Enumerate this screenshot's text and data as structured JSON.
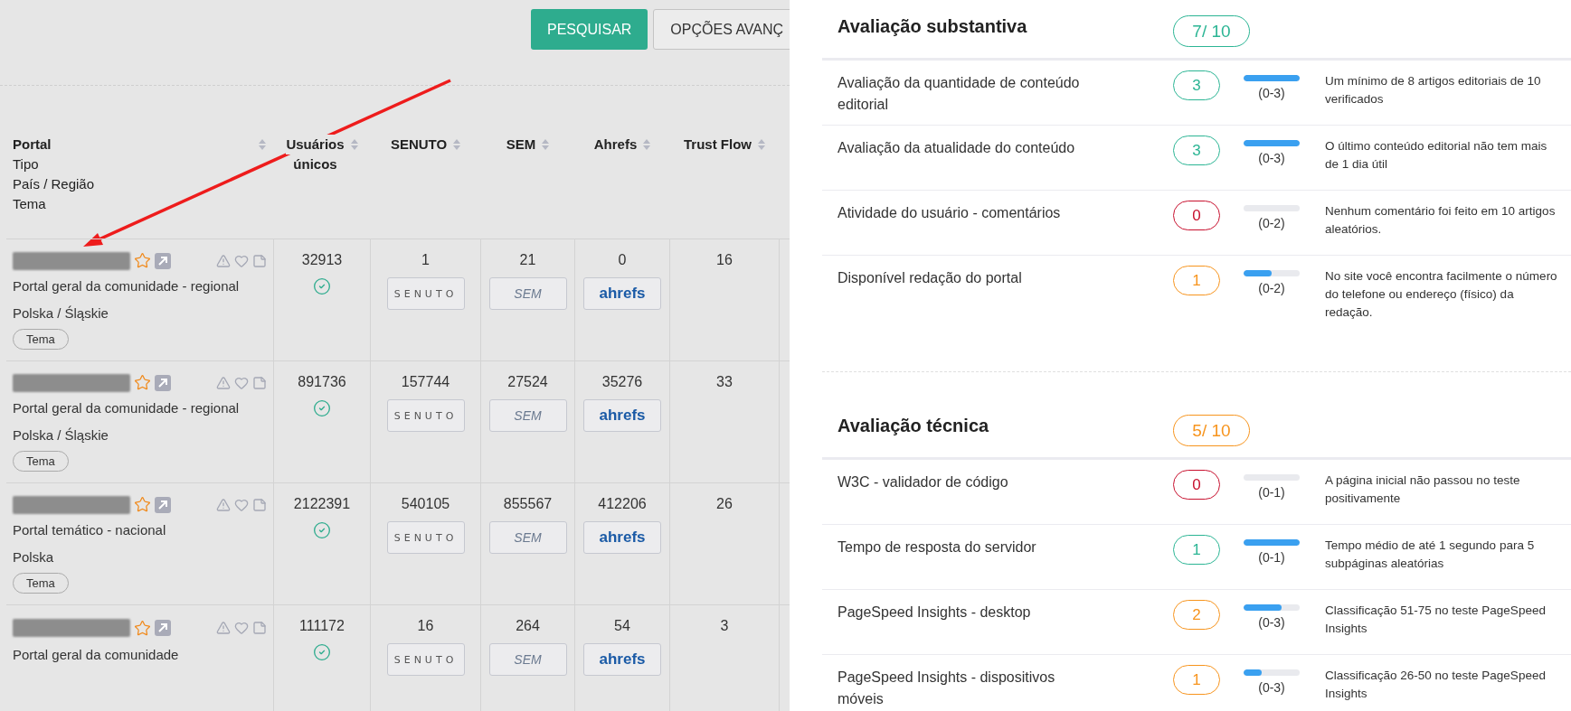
{
  "toolbar": {
    "buttons": [
      {
        "label": "PESQUISAR",
        "kind": "primary"
      },
      {
        "label": "OPÇÕES AVANÇ",
        "kind": "outline"
      }
    ]
  },
  "table": {
    "columns": [
      {
        "lines": [
          "Portal",
          "Tipo",
          "País / Região",
          "Tema"
        ]
      },
      {
        "lines": [
          "Usuários",
          "únicos"
        ]
      },
      {
        "lines": [
          "SENUTO"
        ]
      },
      {
        "lines": [
          "SEM"
        ]
      },
      {
        "lines": [
          "Ahrefs"
        ]
      },
      {
        "lines": [
          "Trust Flow"
        ]
      }
    ],
    "rows": [
      {
        "type": "Portal geral da comunidade - regional",
        "region": "Polska / Śląskie",
        "tag": "Tema",
        "users": "32913",
        "verified": true,
        "senuto": "1",
        "senuto_logo": "SENUTO",
        "sem": "21",
        "sem_logo": "SEM",
        "ahrefs": "0",
        "ahrefs_logo": "ahrefs",
        "trust": "16"
      },
      {
        "type": "Portal geral da comunidade - regional",
        "region": "Polska / Śląskie",
        "tag": "Tema",
        "users": "891736",
        "verified": true,
        "senuto": "157744",
        "senuto_logo": "SENUTO",
        "sem": "27524",
        "sem_logo": "SEM",
        "ahrefs": "35276",
        "ahrefs_logo": "ahrefs",
        "trust": "33"
      },
      {
        "type": "Portal temático - nacional",
        "region": "Polska",
        "tag": "Tema",
        "users": "2122391",
        "verified": true,
        "senuto": "540105",
        "senuto_logo": "SENUTO",
        "sem": "855567",
        "sem_logo": "SEM",
        "ahrefs": "412206",
        "ahrefs_logo": "ahrefs",
        "trust": "26"
      },
      {
        "type": "Portal geral da comunidade",
        "users": "111172",
        "verified": true,
        "senuto": "16",
        "senuto_logo": "SENUTO",
        "sem": "264",
        "sem_logo": "SEM",
        "ahrefs": "54",
        "ahrefs_logo": "ahrefs",
        "trust": "3"
      }
    ]
  },
  "sections": [
    {
      "title": "Avaliação substantiva",
      "score": "7/ 10",
      "color": "#2bb594",
      "items": [
        {
          "name": "Avaliação da quantidade de conteúdo editorial",
          "score": "3",
          "color": "#2bb594",
          "level": 1,
          "range": "(0-3)",
          "description": "Um mínimo de 8 artigos editoriais de 10 verificados"
        },
        {
          "name": "Avaliação da atualidade do conteúdo",
          "score": "3",
          "color": "#2bb594",
          "level": 1,
          "range": "(0-3)",
          "description": "O último conteúdo editorial não tem mais de 1 dia útil"
        },
        {
          "name": "Atividade do usuário - comentários",
          "score": "0",
          "color": "#c8102e",
          "level": 0,
          "range": "(0-2)",
          "description": "Nenhum comentário foi feito em 10 artigos aleatórios."
        },
        {
          "name": "Disponível redação do portal",
          "score": "1",
          "color": "#f7941d",
          "level": 0.5,
          "range": "(0-2)",
          "description": "No site você encontra facilmente o número do telefone ou endereço (físico) da redação."
        }
      ]
    },
    {
      "title": "Avaliação técnica",
      "score": "5/ 10",
      "color": "#f7941d",
      "items": [
        {
          "name": "W3C - validador de código",
          "score": "0",
          "color": "#c8102e",
          "level": 0,
          "range": "(0-1)",
          "description": "A página inicial não passou no teste positivamente"
        },
        {
          "name": "Tempo de resposta do servidor",
          "score": "1",
          "color": "#2bb594",
          "level": 1,
          "range": "(0-1)",
          "description": "Tempo médio de até 1 segundo para 5 subpáginas aleatórias"
        },
        {
          "name": "PageSpeed Insights - desktop",
          "score": "2",
          "color": "#f7941d",
          "level": 0.67,
          "range": "(0-3)",
          "description": "Classificação 51-75 no teste PageSpeed Insights"
        },
        {
          "name": "PageSpeed Insights - dispositivos móveis",
          "score": "1",
          "color": "#f7941d",
          "level": 0.33,
          "range": "(0-3)",
          "description": "Classificação 26-50 no teste PageSpeed Insights"
        }
      ]
    }
  ]
}
